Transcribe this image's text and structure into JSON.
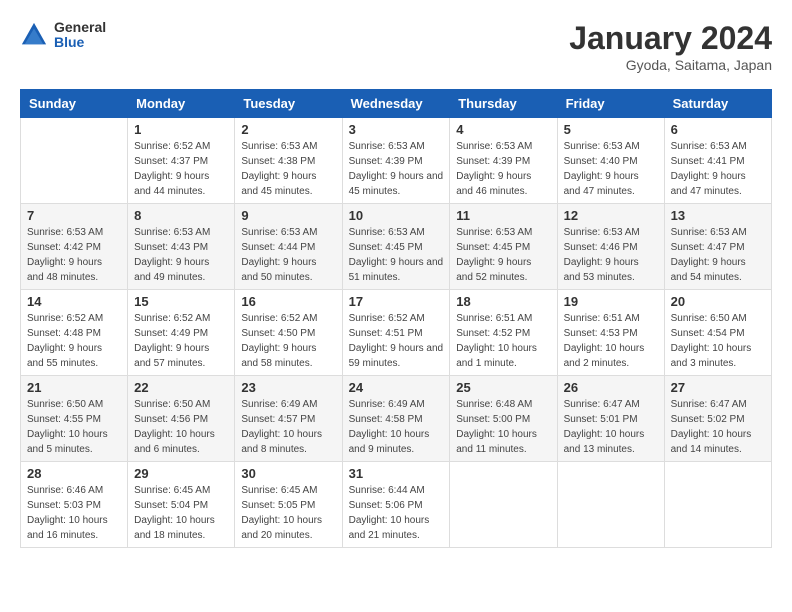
{
  "header": {
    "logo": {
      "general": "General",
      "blue": "Blue"
    },
    "title": "January 2024",
    "subtitle": "Gyoda, Saitama, Japan"
  },
  "calendar": {
    "days_of_week": [
      "Sunday",
      "Monday",
      "Tuesday",
      "Wednesday",
      "Thursday",
      "Friday",
      "Saturday"
    ],
    "weeks": [
      [
        {
          "day": "",
          "sunrise": "",
          "sunset": "",
          "daylight": ""
        },
        {
          "day": "1",
          "sunrise": "Sunrise: 6:52 AM",
          "sunset": "Sunset: 4:37 PM",
          "daylight": "Daylight: 9 hours and 44 minutes."
        },
        {
          "day": "2",
          "sunrise": "Sunrise: 6:53 AM",
          "sunset": "Sunset: 4:38 PM",
          "daylight": "Daylight: 9 hours and 45 minutes."
        },
        {
          "day": "3",
          "sunrise": "Sunrise: 6:53 AM",
          "sunset": "Sunset: 4:39 PM",
          "daylight": "Daylight: 9 hours and 45 minutes."
        },
        {
          "day": "4",
          "sunrise": "Sunrise: 6:53 AM",
          "sunset": "Sunset: 4:39 PM",
          "daylight": "Daylight: 9 hours and 46 minutes."
        },
        {
          "day": "5",
          "sunrise": "Sunrise: 6:53 AM",
          "sunset": "Sunset: 4:40 PM",
          "daylight": "Daylight: 9 hours and 47 minutes."
        },
        {
          "day": "6",
          "sunrise": "Sunrise: 6:53 AM",
          "sunset": "Sunset: 4:41 PM",
          "daylight": "Daylight: 9 hours and 47 minutes."
        }
      ],
      [
        {
          "day": "7",
          "sunrise": "Sunrise: 6:53 AM",
          "sunset": "Sunset: 4:42 PM",
          "daylight": "Daylight: 9 hours and 48 minutes."
        },
        {
          "day": "8",
          "sunrise": "Sunrise: 6:53 AM",
          "sunset": "Sunset: 4:43 PM",
          "daylight": "Daylight: 9 hours and 49 minutes."
        },
        {
          "day": "9",
          "sunrise": "Sunrise: 6:53 AM",
          "sunset": "Sunset: 4:44 PM",
          "daylight": "Daylight: 9 hours and 50 minutes."
        },
        {
          "day": "10",
          "sunrise": "Sunrise: 6:53 AM",
          "sunset": "Sunset: 4:45 PM",
          "daylight": "Daylight: 9 hours and 51 minutes."
        },
        {
          "day": "11",
          "sunrise": "Sunrise: 6:53 AM",
          "sunset": "Sunset: 4:45 PM",
          "daylight": "Daylight: 9 hours and 52 minutes."
        },
        {
          "day": "12",
          "sunrise": "Sunrise: 6:53 AM",
          "sunset": "Sunset: 4:46 PM",
          "daylight": "Daylight: 9 hours and 53 minutes."
        },
        {
          "day": "13",
          "sunrise": "Sunrise: 6:53 AM",
          "sunset": "Sunset: 4:47 PM",
          "daylight": "Daylight: 9 hours and 54 minutes."
        }
      ],
      [
        {
          "day": "14",
          "sunrise": "Sunrise: 6:52 AM",
          "sunset": "Sunset: 4:48 PM",
          "daylight": "Daylight: 9 hours and 55 minutes."
        },
        {
          "day": "15",
          "sunrise": "Sunrise: 6:52 AM",
          "sunset": "Sunset: 4:49 PM",
          "daylight": "Daylight: 9 hours and 57 minutes."
        },
        {
          "day": "16",
          "sunrise": "Sunrise: 6:52 AM",
          "sunset": "Sunset: 4:50 PM",
          "daylight": "Daylight: 9 hours and 58 minutes."
        },
        {
          "day": "17",
          "sunrise": "Sunrise: 6:52 AM",
          "sunset": "Sunset: 4:51 PM",
          "daylight": "Daylight: 9 hours and 59 minutes."
        },
        {
          "day": "18",
          "sunrise": "Sunrise: 6:51 AM",
          "sunset": "Sunset: 4:52 PM",
          "daylight": "Daylight: 10 hours and 1 minute."
        },
        {
          "day": "19",
          "sunrise": "Sunrise: 6:51 AM",
          "sunset": "Sunset: 4:53 PM",
          "daylight": "Daylight: 10 hours and 2 minutes."
        },
        {
          "day": "20",
          "sunrise": "Sunrise: 6:50 AM",
          "sunset": "Sunset: 4:54 PM",
          "daylight": "Daylight: 10 hours and 3 minutes."
        }
      ],
      [
        {
          "day": "21",
          "sunrise": "Sunrise: 6:50 AM",
          "sunset": "Sunset: 4:55 PM",
          "daylight": "Daylight: 10 hours and 5 minutes."
        },
        {
          "day": "22",
          "sunrise": "Sunrise: 6:50 AM",
          "sunset": "Sunset: 4:56 PM",
          "daylight": "Daylight: 10 hours and 6 minutes."
        },
        {
          "day": "23",
          "sunrise": "Sunrise: 6:49 AM",
          "sunset": "Sunset: 4:57 PM",
          "daylight": "Daylight: 10 hours and 8 minutes."
        },
        {
          "day": "24",
          "sunrise": "Sunrise: 6:49 AM",
          "sunset": "Sunset: 4:58 PM",
          "daylight": "Daylight: 10 hours and 9 minutes."
        },
        {
          "day": "25",
          "sunrise": "Sunrise: 6:48 AM",
          "sunset": "Sunset: 5:00 PM",
          "daylight": "Daylight: 10 hours and 11 minutes."
        },
        {
          "day": "26",
          "sunrise": "Sunrise: 6:47 AM",
          "sunset": "Sunset: 5:01 PM",
          "daylight": "Daylight: 10 hours and 13 minutes."
        },
        {
          "day": "27",
          "sunrise": "Sunrise: 6:47 AM",
          "sunset": "Sunset: 5:02 PM",
          "daylight": "Daylight: 10 hours and 14 minutes."
        }
      ],
      [
        {
          "day": "28",
          "sunrise": "Sunrise: 6:46 AM",
          "sunset": "Sunset: 5:03 PM",
          "daylight": "Daylight: 10 hours and 16 minutes."
        },
        {
          "day": "29",
          "sunrise": "Sunrise: 6:45 AM",
          "sunset": "Sunset: 5:04 PM",
          "daylight": "Daylight: 10 hours and 18 minutes."
        },
        {
          "day": "30",
          "sunrise": "Sunrise: 6:45 AM",
          "sunset": "Sunset: 5:05 PM",
          "daylight": "Daylight: 10 hours and 20 minutes."
        },
        {
          "day": "31",
          "sunrise": "Sunrise: 6:44 AM",
          "sunset": "Sunset: 5:06 PM",
          "daylight": "Daylight: 10 hours and 21 minutes."
        },
        {
          "day": "",
          "sunrise": "",
          "sunset": "",
          "daylight": ""
        },
        {
          "day": "",
          "sunrise": "",
          "sunset": "",
          "daylight": ""
        },
        {
          "day": "",
          "sunrise": "",
          "sunset": "",
          "daylight": ""
        }
      ]
    ]
  }
}
